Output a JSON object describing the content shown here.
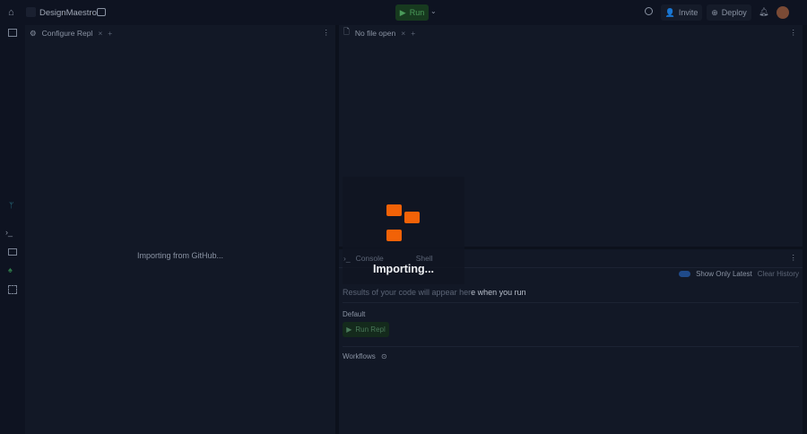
{
  "header": {
    "project": "DesignMaestro",
    "run": "Run",
    "invite": "Invite",
    "deploy": "Deploy"
  },
  "left_panel": {
    "tab": "Configure Repl",
    "status": "Importing from GitHub..."
  },
  "editor": {
    "tab": "No file open"
  },
  "console": {
    "tabs": [
      "Console",
      "Shell"
    ],
    "toggle_label": "Show Only Latest",
    "toggle_on": true,
    "clear": "Clear History",
    "placeholder_dim": "Results of your code will appear her",
    "placeholder_bright": "e when you run",
    "default_label": "Default",
    "run_repl": "Run Repl",
    "workflows": "Workflows"
  },
  "overlay": {
    "text": "Importing...",
    "accent": "#f26207"
  }
}
